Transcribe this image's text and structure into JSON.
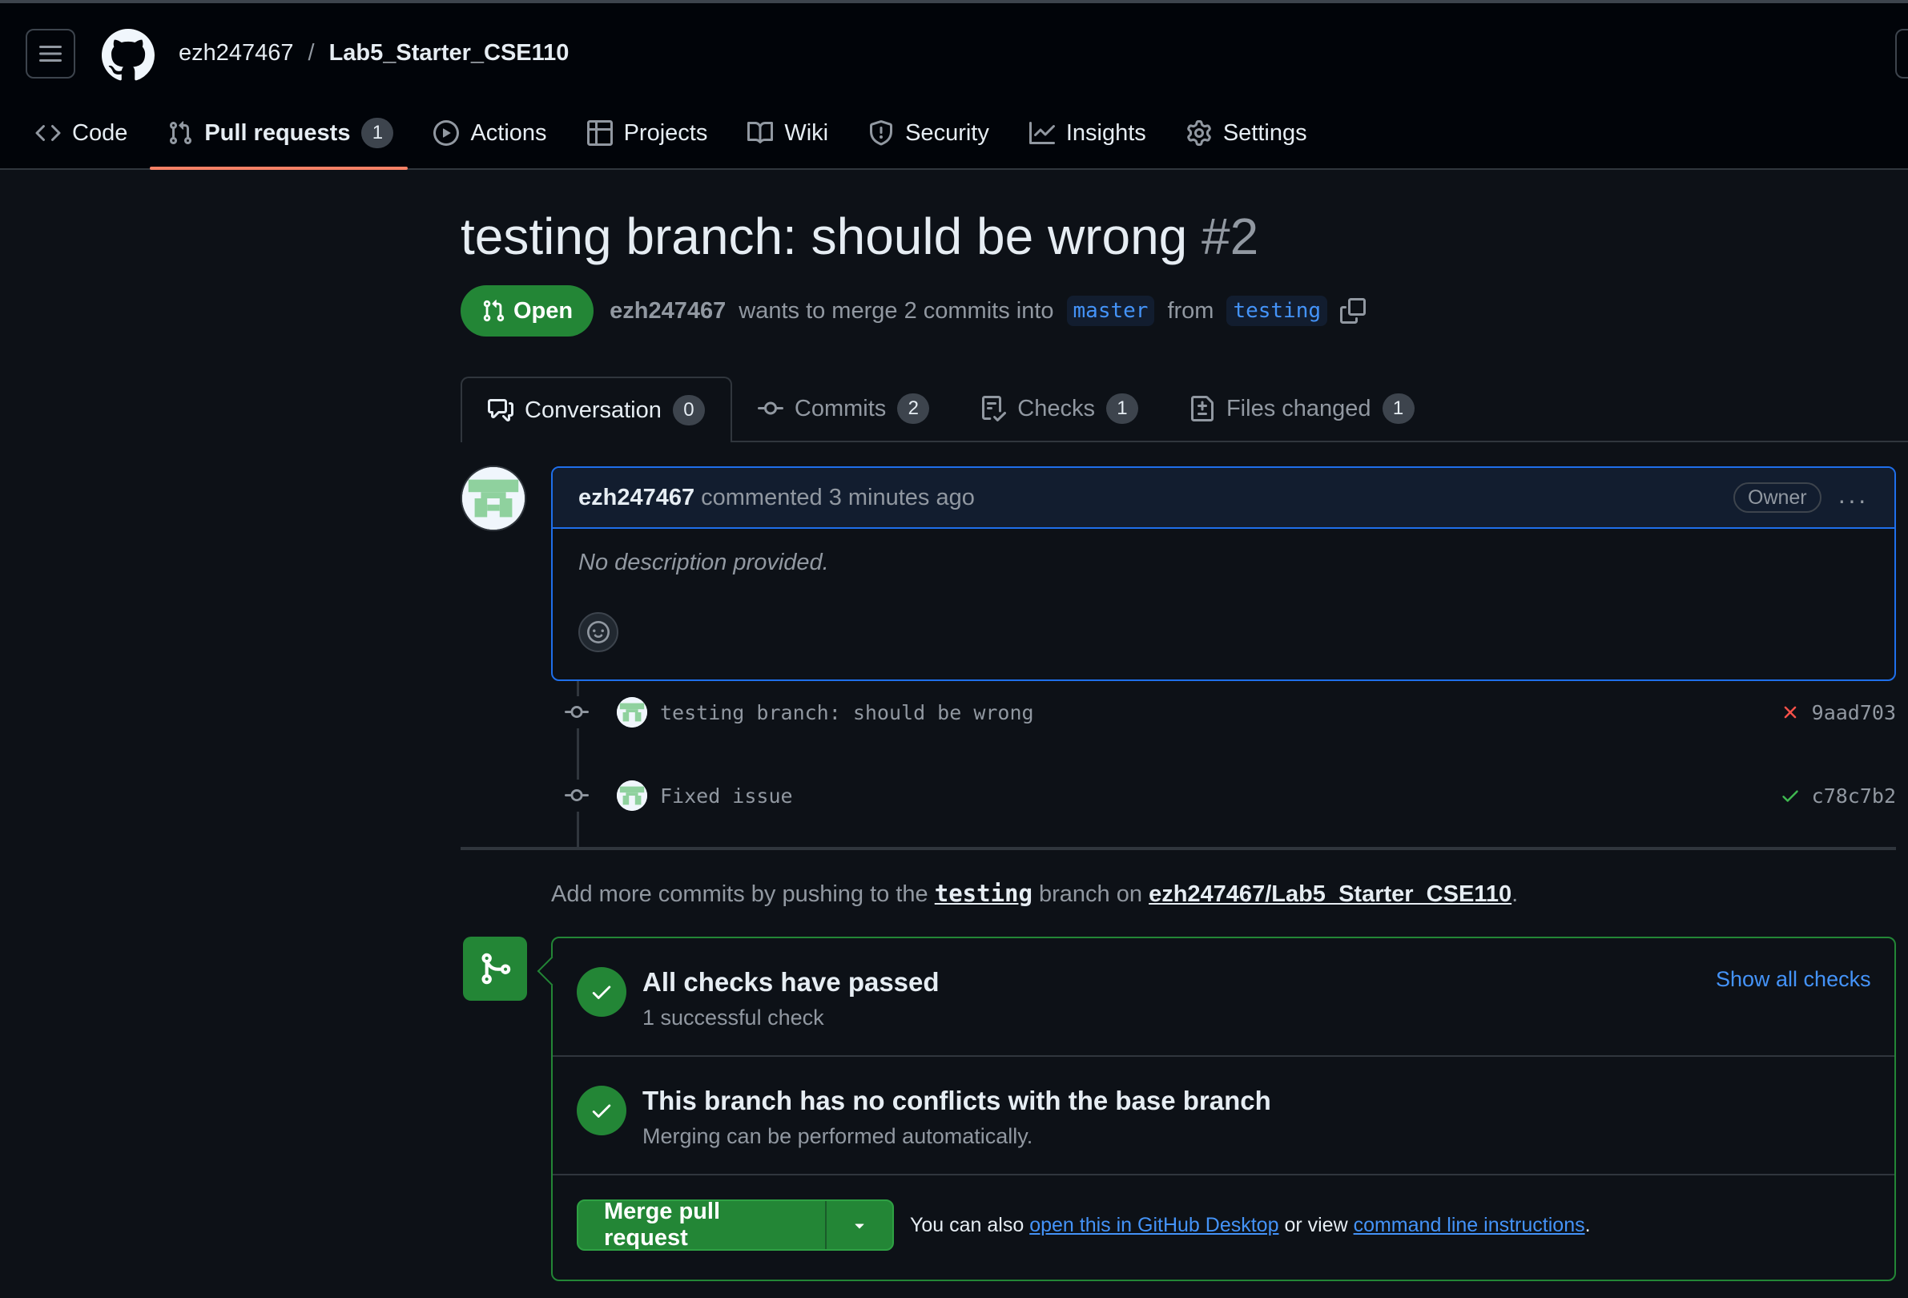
{
  "header": {
    "owner": "ezh247467",
    "separator": "/",
    "repo": "Lab5_Starter_CSE110"
  },
  "nav": {
    "code": "Code",
    "pull_requests": "Pull requests",
    "pull_requests_count": "1",
    "actions": "Actions",
    "projects": "Projects",
    "wiki": "Wiki",
    "security": "Security",
    "insights": "Insights",
    "settings": "Settings"
  },
  "pr": {
    "title": "testing branch: should be wrong",
    "number": "#2",
    "state": "Open",
    "author": "ezh247467",
    "merge_text": "wants to merge 2 commits into",
    "base_branch": "master",
    "from_text": "from",
    "head_branch": "testing"
  },
  "tabs": {
    "conversation": "Conversation",
    "conversation_count": "0",
    "commits": "Commits",
    "commits_count": "2",
    "checks": "Checks",
    "checks_count": "1",
    "files_changed": "Files changed",
    "files_changed_count": "1"
  },
  "comment": {
    "author": "ezh247467",
    "action": "commented 3 minutes ago",
    "owner_badge": "Owner",
    "kebab": "···",
    "body": "No description provided."
  },
  "commits": [
    {
      "message": "testing branch: should be wrong",
      "status": "failure",
      "sha": "9aad703"
    },
    {
      "message": "Fixed issue",
      "status": "success",
      "sha": "c78c7b2"
    }
  ],
  "push_note": {
    "prefix": "Add more commits by pushing to the",
    "branch": "testing",
    "middle": "branch on",
    "repo": "ezh247467/Lab5_Starter_CSE110",
    "suffix": "."
  },
  "merge": {
    "checks_title": "All checks have passed",
    "checks_sub": "1 successful check",
    "show_all": "Show all checks",
    "conflicts_title": "This branch has no conflicts with the base branch",
    "conflicts_sub": "Merging can be performed automatically.",
    "merge_button": "Merge pull request",
    "also_prefix": "You can also",
    "desktop_link": "open this in GitHub Desktop",
    "also_middle": "or view",
    "cli_link": "command line instructions",
    "also_suffix": "."
  },
  "colors": {
    "accent_green": "#238636",
    "link_blue": "#4493f8",
    "nav_underline": "#f78166",
    "fail_red": "#f85149",
    "success_green": "#3fb950"
  }
}
